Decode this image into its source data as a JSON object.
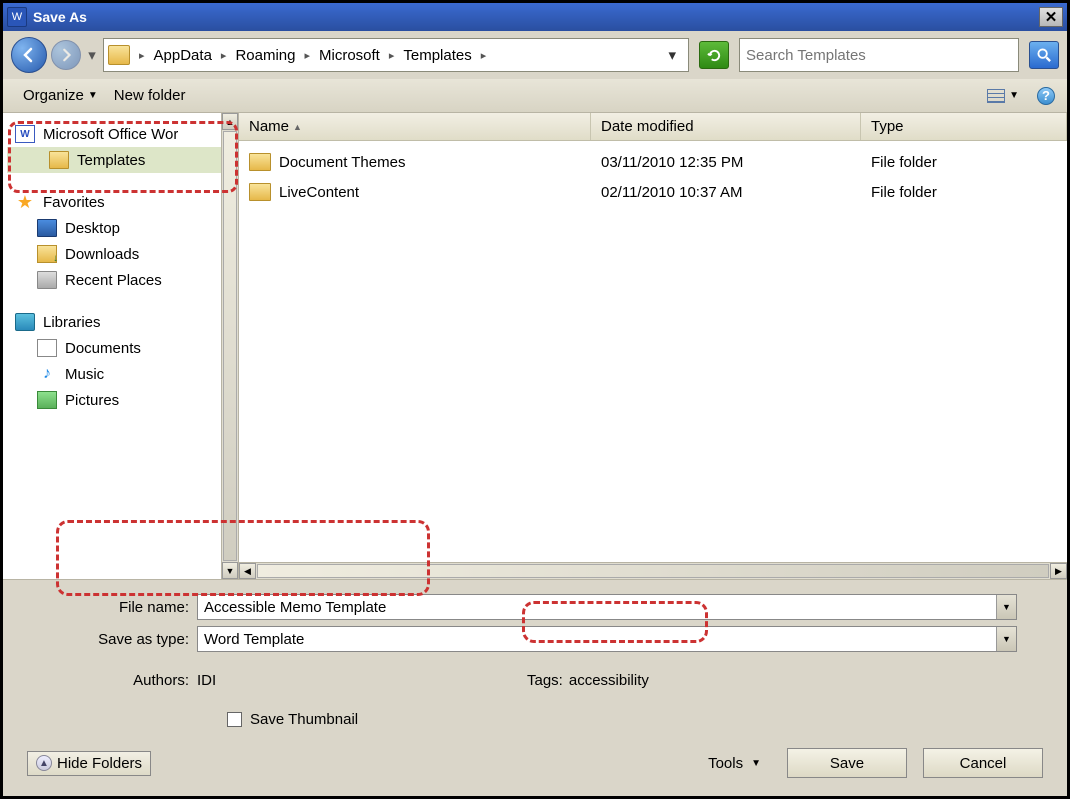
{
  "title": "Save As",
  "breadcrumb": [
    "AppData",
    "Roaming",
    "Microsoft",
    "Templates"
  ],
  "search": {
    "placeholder": "Search Templates"
  },
  "toolbar": {
    "organize": "Organize",
    "new_folder": "New folder"
  },
  "sidebar": {
    "word_item": "Microsoft Office Wor",
    "templates": "Templates",
    "favorites": "Favorites",
    "desktop": "Desktop",
    "downloads": "Downloads",
    "recent": "Recent Places",
    "libraries": "Libraries",
    "documents": "Documents",
    "music": "Music",
    "pictures": "Pictures"
  },
  "columns": {
    "name": "Name",
    "date": "Date modified",
    "type": "Type"
  },
  "files": [
    {
      "name": "Document Themes",
      "date": "03/11/2010 12:35 PM",
      "type": "File folder"
    },
    {
      "name": "LiveContent",
      "date": "02/11/2010 10:37 AM",
      "type": "File folder"
    }
  ],
  "form": {
    "filename_label": "File name:",
    "filename_value": "Accessible Memo Template",
    "savetype_label": "Save as type:",
    "savetype_value": "Word Template",
    "authors_label": "Authors:",
    "authors_value": "IDI",
    "tags_label": "Tags:",
    "tags_value": "accessibility",
    "thumb_label": "Save Thumbnail"
  },
  "footer": {
    "hide": "Hide Folders",
    "tools": "Tools",
    "save": "Save",
    "cancel": "Cancel"
  }
}
